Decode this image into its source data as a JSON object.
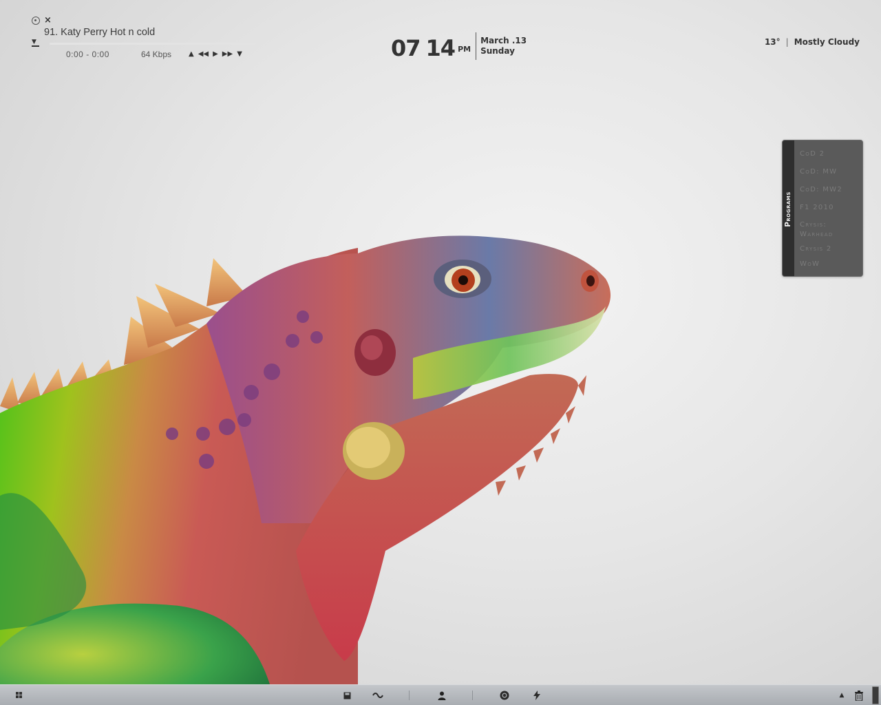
{
  "player": {
    "track_title": "91. Katy Perry Hot n cold",
    "time": "0:00 - 0:00",
    "bitrate": "64 Kbps",
    "progress_fraction": 0,
    "icons": [
      "pin-icon",
      "close-icon",
      "eject-icon",
      "volume-up-icon",
      "previous-icon",
      "play-icon",
      "next-icon",
      "volume-down-icon"
    ]
  },
  "clock": {
    "hour": "07",
    "minute": "14",
    "ampm": "PM",
    "date": "March .13",
    "weekday": "Sunday"
  },
  "weather": {
    "temperature": "13°",
    "condition": "Mostly Cloudy"
  },
  "programs": {
    "title": "Programs",
    "items": [
      "CoD 2",
      "CoD: MW",
      "CoD: MW2",
      "F1 2010",
      "Crysis: Warhead",
      "Crysis 2",
      "WoW"
    ]
  },
  "taskbar": {
    "icons": [
      "start-icon",
      "save-icon",
      "link-icon",
      "user-icon",
      "chrome-icon",
      "lightning-icon",
      "tray-arrow-icon",
      "trash-icon",
      "show-desktop-icon"
    ]
  },
  "colors": {
    "background": "#e6e6e6",
    "text": "#333333",
    "programs_panel": "#5a5a5a",
    "programs_spine": "#2e2e2e",
    "taskbar": "#b3b7bb"
  }
}
